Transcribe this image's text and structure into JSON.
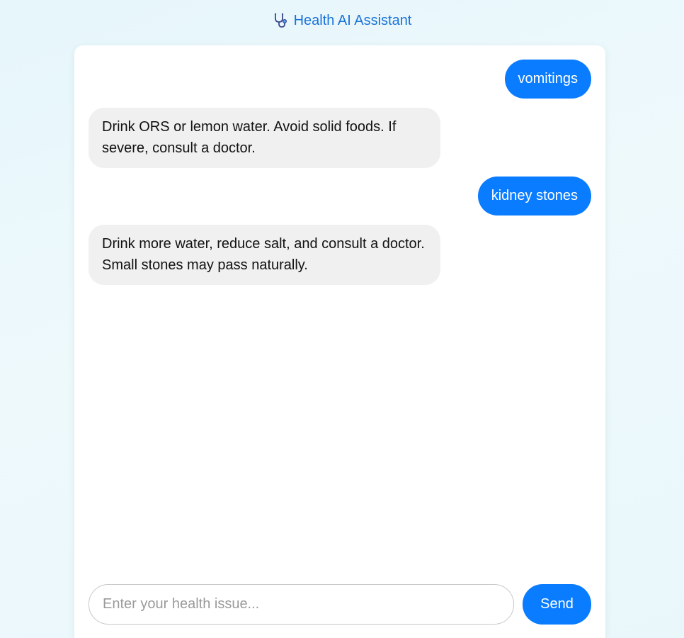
{
  "header": {
    "icon": "stethoscope-icon",
    "title": "Health AI Assistant"
  },
  "messages": [
    {
      "role": "user",
      "text": "vomitings"
    },
    {
      "role": "assistant",
      "text": "Drink ORS or lemon water. Avoid solid foods. If severe, consult a doctor."
    },
    {
      "role": "user",
      "text": "kidney stones"
    },
    {
      "role": "assistant",
      "text": "Drink more water, reduce salt, and consult a doctor. Small stones may pass naturally."
    }
  ],
  "composer": {
    "placeholder": "Enter your health issue...",
    "value": "",
    "send_label": "Send"
  },
  "colors": {
    "accent": "#0a7cff",
    "title": "#1a73d9",
    "bot_bubble": "#f0f0f0",
    "background": "#e8f7fb"
  }
}
